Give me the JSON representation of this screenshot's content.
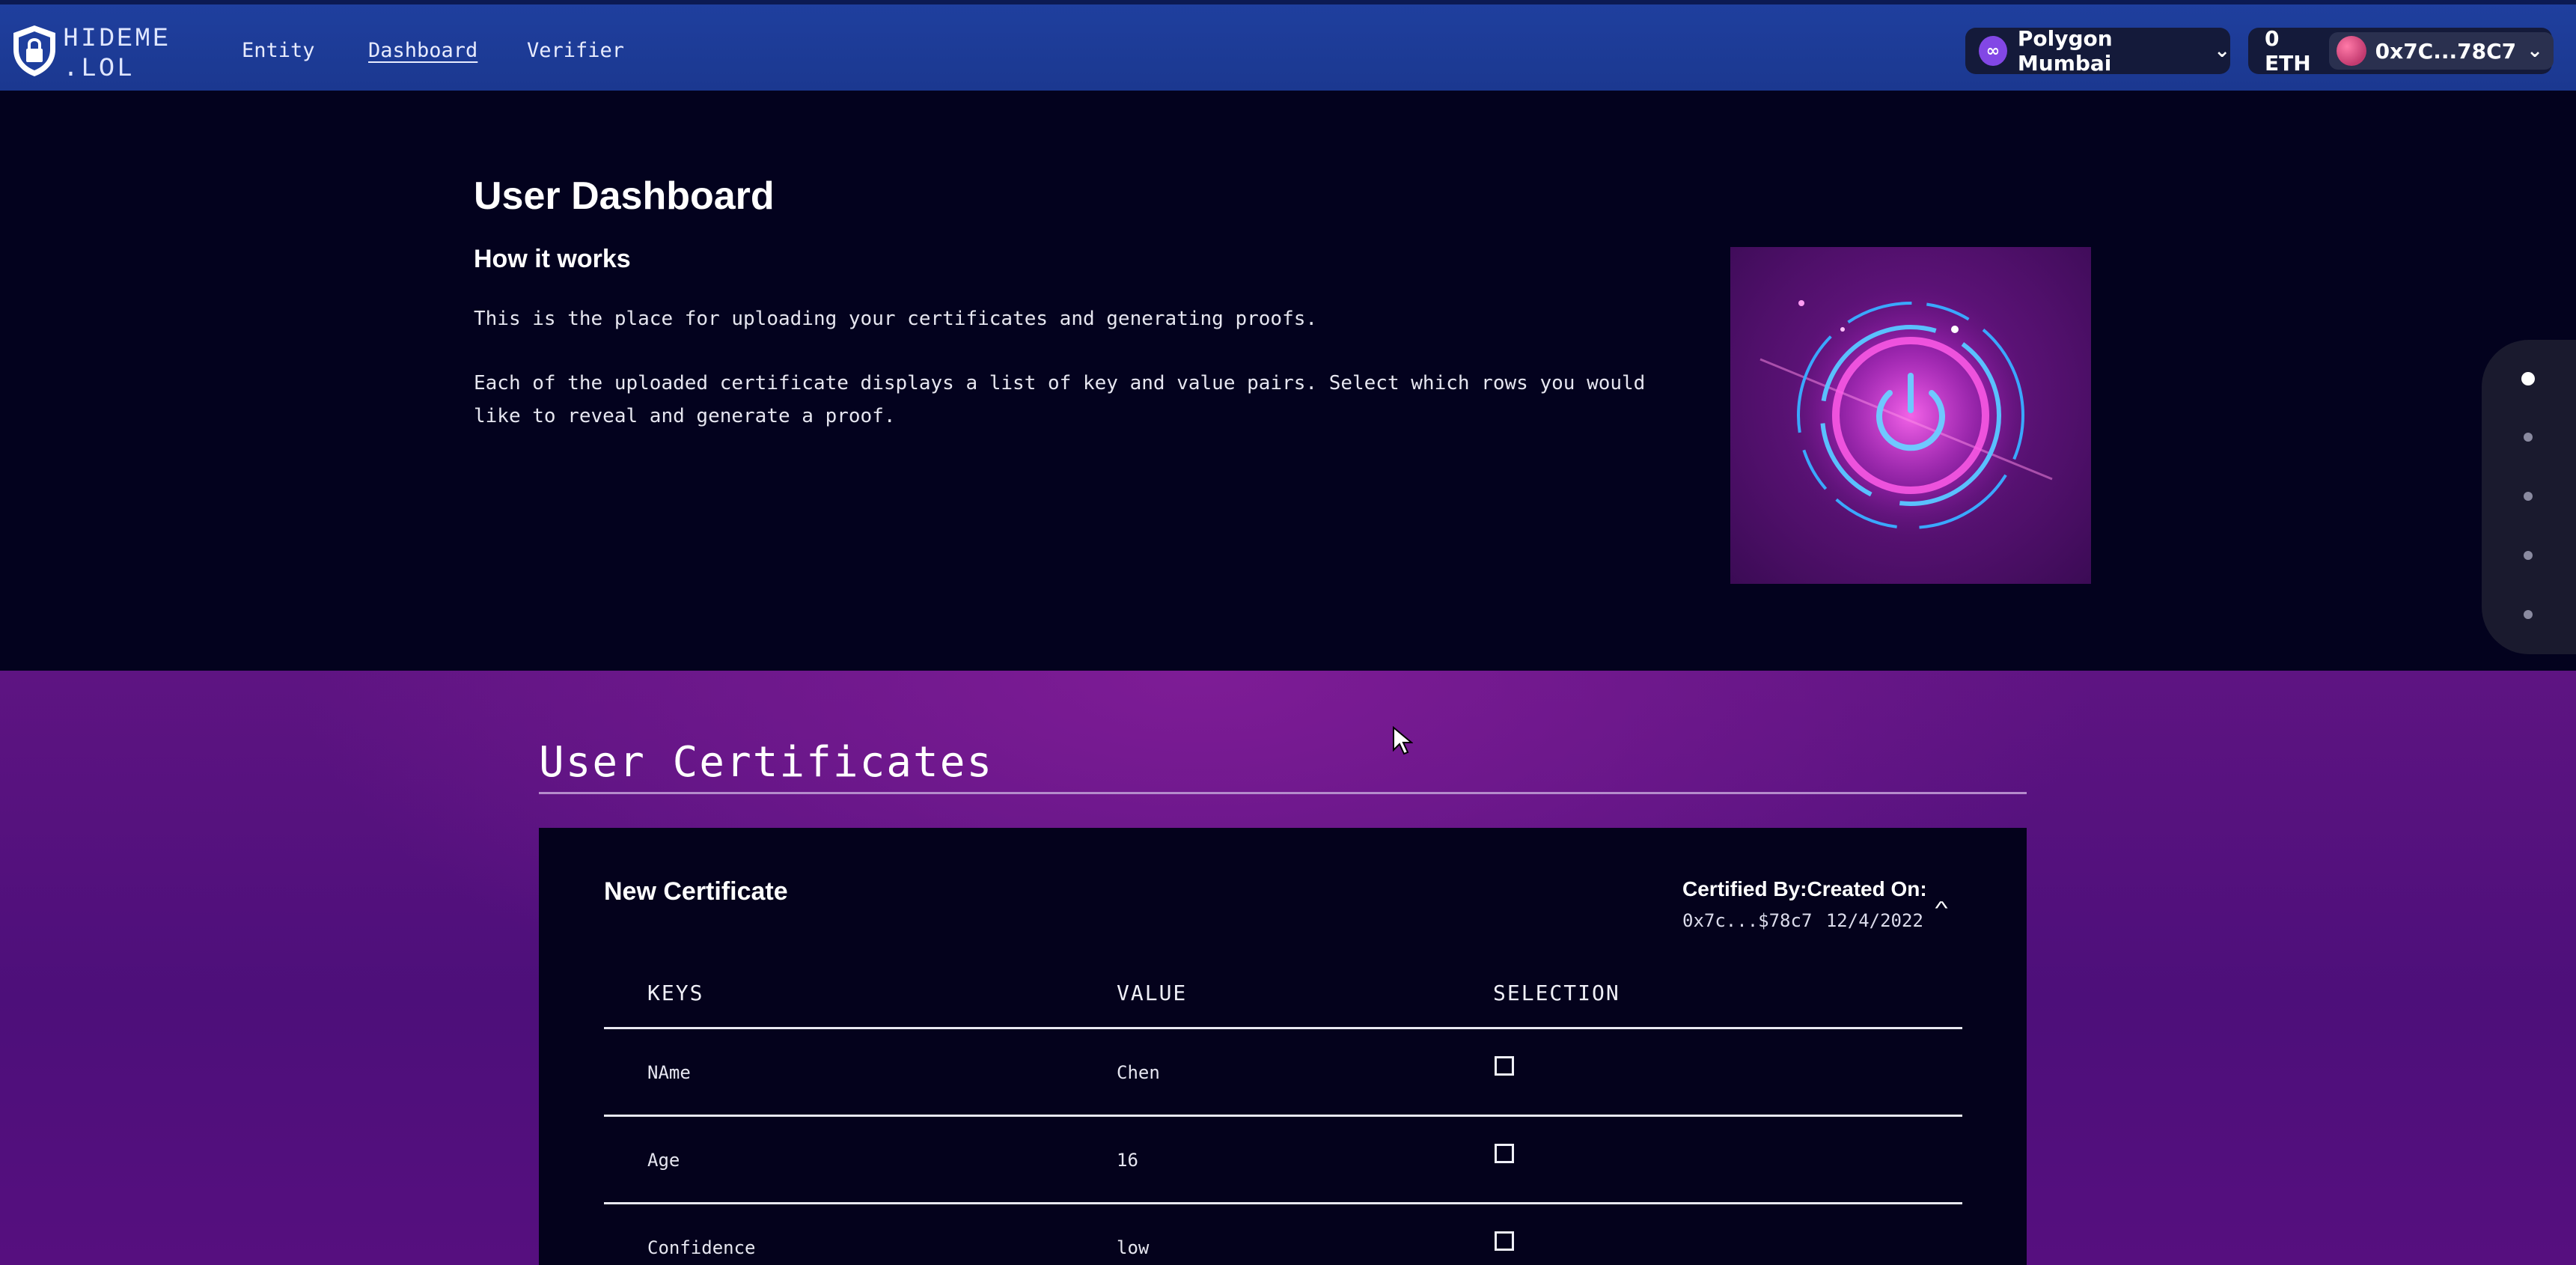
{
  "header": {
    "logo_line1": "HIDEME",
    "logo_line2": ".LOL",
    "nav": {
      "entity": "Entity",
      "dashboard": "Dashboard",
      "verifier": "Verifier"
    },
    "network": "Polygon Mumbai",
    "balance": "0 ETH",
    "account": "0x7C...78C7",
    "brand_color": "#1f3f9e"
  },
  "hero": {
    "title": "User Dashboard",
    "subtitle": "How it works",
    "paragraph1": "This is the place for uploading your certificates and generating proofs.",
    "paragraph2": "Each of the uploaded certificate displays a list of key and value pairs. Select which rows you would like to reveal and generate a proof."
  },
  "certificates": {
    "section_title": "User Certificates",
    "card": {
      "title": "New Certificate",
      "meta_label": "Certified By:Created On:",
      "certified_by": "0x7c...$78c7",
      "created_on": "12/4/2022",
      "columns": {
        "keys": "KEYS",
        "value": "VALUE",
        "selection": "SELECTION"
      },
      "rows": [
        {
          "key": "NAme",
          "value": "Chen",
          "selected": false
        },
        {
          "key": "Age",
          "value": "16",
          "selected": false
        },
        {
          "key": "Confidence",
          "value": "low",
          "selected": false
        }
      ]
    }
  }
}
